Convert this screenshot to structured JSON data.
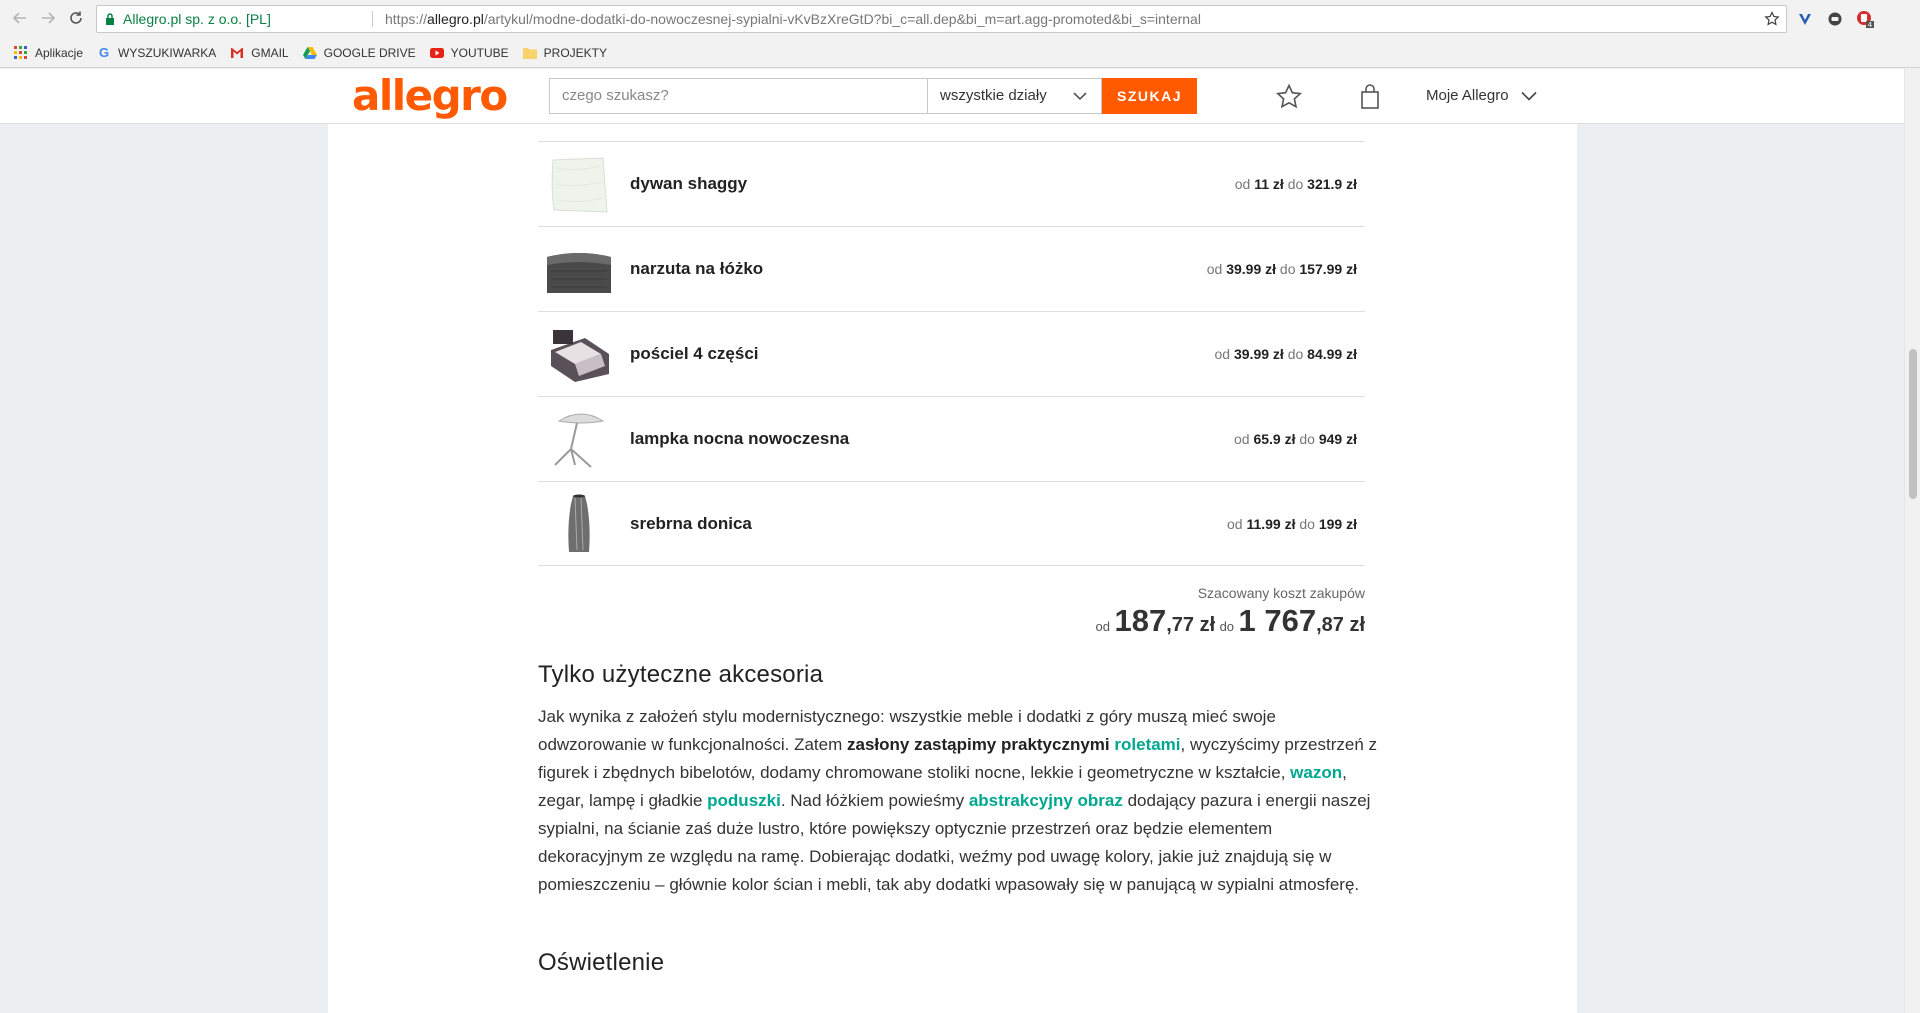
{
  "browser": {
    "site_name": "Allegro.pl sp. z o.o. [PL]",
    "url_prefix": "https://",
    "url_host": "allegro.pl",
    "url_path": "/artykul/modne-dodatki-do-nowoczesnej-sypialni-vKvBzXreGtD?bi_c=all.dep&bi_m=art.agg-promoted&bi_s=internal",
    "ext_badge": "4"
  },
  "bookmarks": [
    {
      "label": "Aplikacje",
      "icon": "apps-grid-icon"
    },
    {
      "label": "WYSZUKIWARKA",
      "icon": "google-icon"
    },
    {
      "label": "GMAIL",
      "icon": "gmail-icon"
    },
    {
      "label": "GOOGLE DRIVE",
      "icon": "drive-icon"
    },
    {
      "label": "YOUTUBE",
      "icon": "youtube-icon"
    },
    {
      "label": "PROJEKTY",
      "icon": "folder-icon"
    }
  ],
  "header": {
    "logo": "allegro",
    "search_placeholder": "czego szukasz?",
    "department": "wszystkie działy",
    "search_button": "SZUKAJ",
    "my_allegro": "Moje Allegro"
  },
  "products": [
    {
      "name": "dywan shaggy",
      "from_label": "od",
      "from": "11 zł",
      "to_label": "do",
      "to": "321.9 zł"
    },
    {
      "name": "narzuta na łóżko",
      "from_label": "od",
      "from": "39.99 zł",
      "to_label": "do",
      "to": "157.99 zł"
    },
    {
      "name": "pościel 4 części",
      "from_label": "od",
      "from": "39.99 zł",
      "to_label": "do",
      "to": "84.99 zł"
    },
    {
      "name": "lampka nocna nowoczesna",
      "from_label": "od",
      "from": "65.9 zł",
      "to_label": "do",
      "to": "949 zł"
    },
    {
      "name": "srebrna donica",
      "from_label": "od",
      "from": "11.99 zł",
      "to_label": "do",
      "to": "199 zł"
    }
  ],
  "estimate": {
    "label": "Szacowany koszt zakupów",
    "from_label": "od",
    "from_int": "187",
    "from_dec": ",77 zł",
    "to_label": "do",
    "to_int": "1 767",
    "to_dec": ",87 zł"
  },
  "article": {
    "heading1": "Tylko użyteczne akcesoria",
    "p1_a": "Jak wynika z założeń stylu modernistycznego: wszystkie meble i dodatki z góry muszą mieć swoje odwzorowanie w funkcjonalności. Zatem ",
    "p1_bold": "zasłony zastąpimy praktycznymi",
    "p1_link1": "roletami",
    "p1_b": ", wyczyścimy przestrzeń z figurek i zbędnych bibelotów, dodamy chromowane stoliki nocne, lekkie i geometryczne w kształcie, ",
    "p1_link2": "wazon",
    "p1_c": ", zegar, lampę i gładkie ",
    "p1_link3": "poduszki",
    "p1_d": ". Nad łóżkiem powieśmy ",
    "p1_link4": "abstrakcyjny obraz",
    "p1_e": " dodający pazura i energii naszej sypialni, na ścianie zaś duże lustro, które powiększy optycznie przestrzeń oraz będzie elementem dekoracyjnym ze względu na ramę. Dobierając dodatki, weźmy pod uwagę kolory, jakie już znajdują się w pomieszczeniu – głównie kolor ścian i mebli, tak aby dodatki wpasowały się w panującą w sypialni atmosferę.",
    "heading2": "Oświetlenie"
  },
  "colors": {
    "brand": "#ff5a00",
    "link": "#00a790",
    "secure": "#0b8043"
  }
}
